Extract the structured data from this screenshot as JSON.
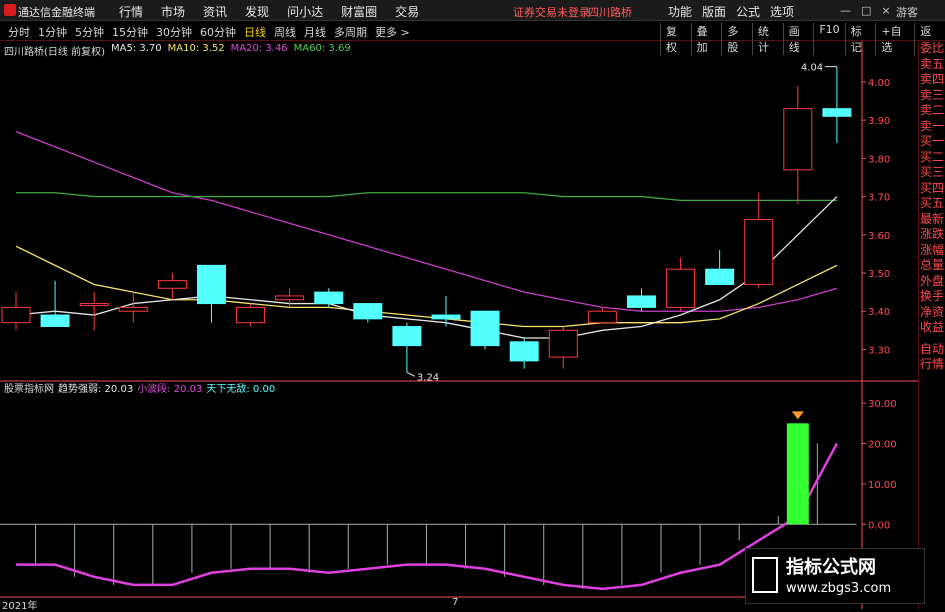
{
  "app": {
    "title": "通达信金融终端"
  },
  "top_menu": [
    "行情",
    "市场",
    "资讯",
    "发现",
    "问小达",
    "财富圈",
    "交易"
  ],
  "notice": "证券交易未登录",
  "stock_tab": "四川路桥",
  "right_menu": [
    "功能",
    "版面",
    "公式",
    "选项"
  ],
  "guest": "游客",
  "periods": [
    "分时",
    "1分钟",
    "5分钟",
    "15分钟",
    "30分钟",
    "60分钟",
    "日线",
    "周线",
    "月线",
    "多周期",
    "更多 >"
  ],
  "active_period": "日线",
  "tools": [
    "复权",
    "叠加",
    "多股",
    "统计",
    "画线",
    "F10",
    "标记",
    "+自选",
    "返回"
  ],
  "legend": {
    "name": "四川路桥(日线 前复权)",
    "ma5": "MA5: 3.70",
    "ma10": "MA10: 3.52",
    "ma20": "MA20: 3.46",
    "ma60": "MA60: 3.69"
  },
  "indicator": {
    "name": "股票指标网",
    "l1": "趋势强弱: 20.03",
    "l2": "小波段: 20.03",
    "l3": "天下无敌: 0.00"
  },
  "side_panel": [
    "委比",
    "卖五",
    "卖四",
    "卖三",
    "卖二",
    "卖一",
    "买一",
    "买二",
    "买三",
    "买四",
    "买五",
    "最新",
    "涨跌",
    "涨幅",
    "总量",
    "外盘",
    "换手",
    "净资",
    "收益"
  ],
  "side_panel2": [
    "自动",
    "行情"
  ],
  "bottom_labels": {
    "year": "2021年",
    "month": "7"
  },
  "watermark": {
    "line1": "指标公式网",
    "line2": "www.zbgs3.com"
  },
  "colors": {
    "up": "#ff3b3b",
    "down": "#54ffff",
    "ma5": "#e6e6e6",
    "ma10": "#f5e46b",
    "ma20": "#c83fc8",
    "ma60": "#3fa83f",
    "bar": "#33ff33",
    "axis": "#ff4b4b"
  },
  "chart_data": [
    {
      "type": "candlestick",
      "title": "四川路桥(日线 前复权)",
      "y_ticks": [
        "4.00",
        "3.90",
        "3.80",
        "3.70",
        "3.60",
        "3.50",
        "3.40",
        "3.30"
      ],
      "ylim": [
        3.22,
        4.06
      ],
      "annotations": [
        "4.04",
        "3.24"
      ],
      "candles": [
        {
          "o": 3.37,
          "h": 3.45,
          "l": 3.35,
          "c": 3.41
        },
        {
          "o": 3.39,
          "h": 3.48,
          "l": 3.36,
          "c": 3.36
        },
        {
          "o": 3.42,
          "h": 3.45,
          "l": 3.35,
          "c": 3.42
        },
        {
          "o": 3.4,
          "h": 3.45,
          "l": 3.37,
          "c": 3.41
        },
        {
          "o": 3.46,
          "h": 3.5,
          "l": 3.43,
          "c": 3.48
        },
        {
          "o": 3.52,
          "h": 3.52,
          "l": 3.37,
          "c": 3.42
        },
        {
          "o": 3.37,
          "h": 3.42,
          "l": 3.36,
          "c": 3.41
        },
        {
          "o": 3.43,
          "h": 3.46,
          "l": 3.41,
          "c": 3.44
        },
        {
          "o": 3.45,
          "h": 3.46,
          "l": 3.41,
          "c": 3.42
        },
        {
          "o": 3.42,
          "h": 3.42,
          "l": 3.37,
          "c": 3.38
        },
        {
          "o": 3.36,
          "h": 3.37,
          "l": 3.24,
          "c": 3.31
        },
        {
          "o": 3.39,
          "h": 3.44,
          "l": 3.36,
          "c": 3.38
        },
        {
          "o": 3.4,
          "h": 3.4,
          "l": 3.3,
          "c": 3.31
        },
        {
          "o": 3.32,
          "h": 3.33,
          "l": 3.25,
          "c": 3.27
        },
        {
          "o": 3.28,
          "h": 3.36,
          "l": 3.25,
          "c": 3.35
        },
        {
          "o": 3.37,
          "h": 3.41,
          "l": 3.37,
          "c": 3.4
        },
        {
          "o": 3.44,
          "h": 3.46,
          "l": 3.4,
          "c": 3.41
        },
        {
          "o": 3.41,
          "h": 3.54,
          "l": 3.4,
          "c": 3.51
        },
        {
          "o": 3.51,
          "h": 3.56,
          "l": 3.47,
          "c": 3.47
        },
        {
          "o": 3.47,
          "h": 3.71,
          "l": 3.46,
          "c": 3.64
        },
        {
          "o": 3.77,
          "h": 3.99,
          "l": 3.68,
          "c": 3.93
        },
        {
          "o": 3.93,
          "h": 4.04,
          "l": 3.84,
          "c": 3.91
        }
      ],
      "ma5": [
        3.39,
        3.4,
        3.39,
        3.42,
        3.43,
        3.44,
        3.43,
        3.42,
        3.42,
        3.39,
        3.38,
        3.37,
        3.35,
        3.33,
        3.33,
        3.35,
        3.36,
        3.39,
        3.43,
        3.5,
        3.6,
        3.7
      ],
      "ma10": [
        3.57,
        3.52,
        3.47,
        3.45,
        3.43,
        3.43,
        3.42,
        3.41,
        3.41,
        3.4,
        3.39,
        3.38,
        3.37,
        3.36,
        3.36,
        3.37,
        3.37,
        3.37,
        3.38,
        3.42,
        3.47,
        3.52
      ],
      "ma20": [
        3.87,
        3.83,
        3.79,
        3.75,
        3.71,
        3.69,
        3.66,
        3.63,
        3.6,
        3.57,
        3.54,
        3.51,
        3.48,
        3.45,
        3.43,
        3.41,
        3.4,
        3.4,
        3.4,
        3.41,
        3.43,
        3.46
      ],
      "ma60": [
        3.71,
        3.71,
        3.7,
        3.7,
        3.7,
        3.7,
        3.7,
        3.7,
        3.7,
        3.71,
        3.71,
        3.71,
        3.71,
        3.71,
        3.7,
        3.7,
        3.7,
        3.69,
        3.69,
        3.69,
        3.69,
        3.69
      ]
    },
    {
      "type": "bar",
      "title": "股票指标网",
      "y_ticks": [
        "30.00",
        "20.00",
        "10.00",
        "0.00"
      ],
      "ylim": [
        -18,
        33
      ],
      "trend": [
        -10,
        -10,
        -13,
        -15,
        -15,
        -12,
        -11,
        -11,
        -12,
        -11,
        -10,
        -10,
        -11,
        -13,
        -15,
        -16,
        -15,
        -12,
        -10,
        -4,
        2,
        20
      ],
      "bars": [
        0,
        0,
        0,
        0,
        0,
        0,
        0,
        0,
        0,
        0,
        0,
        0,
        0,
        0,
        0,
        0,
        0,
        0,
        0,
        0,
        25,
        0
      ]
    }
  ]
}
